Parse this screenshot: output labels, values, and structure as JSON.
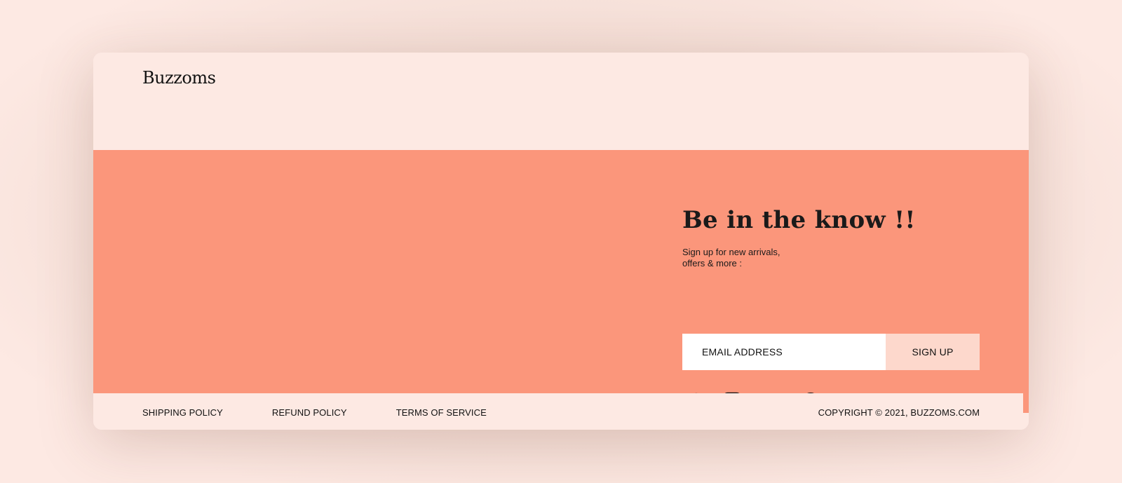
{
  "brand": {
    "logo_text": "Buzzoms"
  },
  "signup": {
    "title": "Be in the know !!",
    "subtitle_line1": "Sign up for new arrivals,",
    "subtitle_line2": "offers & more :",
    "email_placeholder": "EMAIL ADDRESS",
    "button_label": "SIGN UP"
  },
  "social": {
    "icons": [
      "facebook-icon",
      "instagram-icon",
      "twitter-icon",
      "spotify-icon"
    ]
  },
  "footer": {
    "links": [
      "SHIPPING POLICY",
      "REFUND POLICY",
      "TERMS OF SERVICE"
    ],
    "copyright": "COPYRIGHT © 2021, BUZZOMS.COM"
  },
  "colors": {
    "page_bg": "#fde9e3",
    "hero_bg": "#fb967b",
    "button_bg": "#fdd8cc",
    "input_bg": "#ffffff",
    "text": "#111111"
  }
}
